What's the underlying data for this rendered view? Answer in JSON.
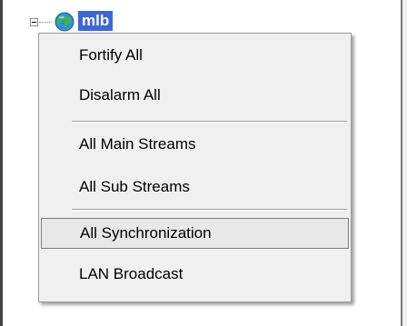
{
  "tree": {
    "node_label": "mlb",
    "node_icon": "globe-icon",
    "expander_icon": "collapse-minus-icon"
  },
  "context_menu": {
    "items": [
      {
        "label": "Fortify All"
      },
      {
        "label": "Disalarm All"
      },
      {
        "label": "All Main Streams"
      },
      {
        "label": "All Sub Streams"
      },
      {
        "label": "All Synchronization",
        "highlighted": true
      },
      {
        "label": "LAN Broadcast"
      }
    ]
  },
  "colors": {
    "selection_blue": "#3c67d9",
    "menu_background": "#f0f0f0",
    "highlight_border": "#7f7f7f"
  }
}
